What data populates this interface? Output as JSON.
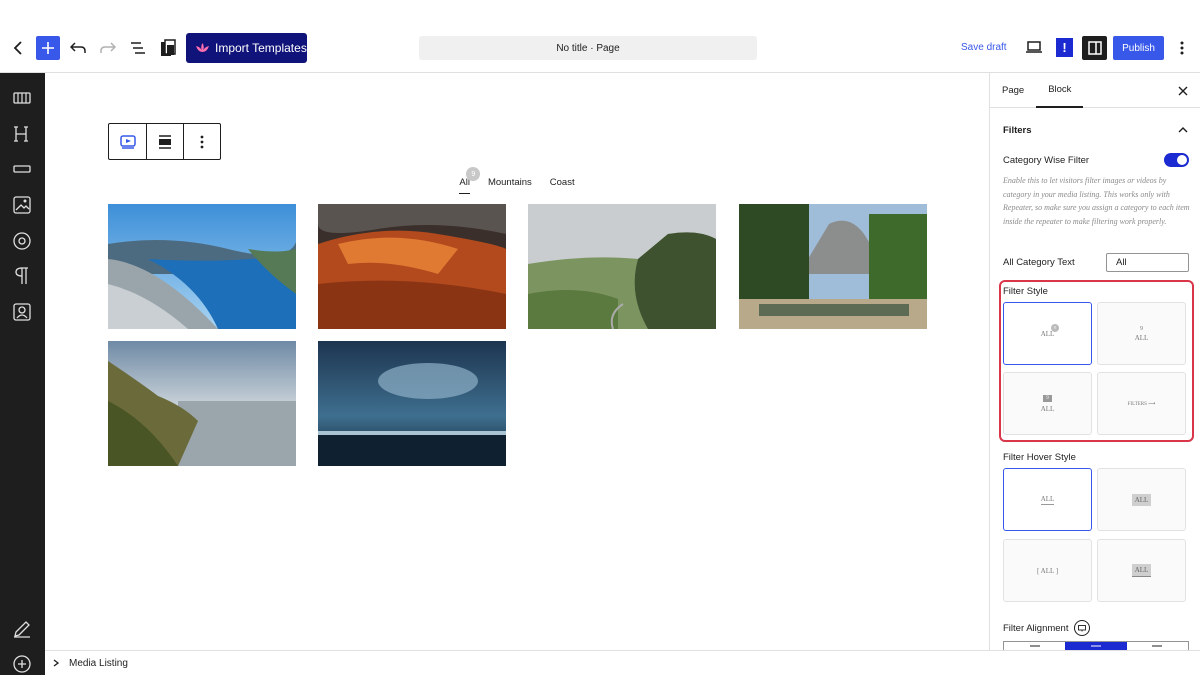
{
  "topbar": {
    "import_templates_label": "Import Templates",
    "document_title": "No title · Page",
    "save_draft_label": "Save draft",
    "alert_label": "!",
    "publish_label": "Publish",
    "colors": {
      "accent": "#3858e9",
      "import_bg": "#10147a",
      "alert_bg": "#1c2bd1"
    }
  },
  "leftbar": {
    "icons": [
      "slides-icon",
      "heading-icon",
      "divider-icon",
      "image-icon",
      "target-icon",
      "paragraph-icon",
      "contact-icon",
      "edit-icon",
      "add-circle-icon"
    ]
  },
  "canvas": {
    "filters": [
      {
        "label": "All",
        "count": "9",
        "active": true
      },
      {
        "label": "Mountains",
        "active": false
      },
      {
        "label": "Coast",
        "active": false
      }
    ],
    "images": [
      {
        "name": "fjord-cliff"
      },
      {
        "name": "red-canyon"
      },
      {
        "name": "green-valley-road"
      },
      {
        "name": "yosemite-valley"
      },
      {
        "name": "coastal-sunset"
      },
      {
        "name": "stormy-sea"
      }
    ]
  },
  "breadcrumb": {
    "label": "Media Listing"
  },
  "sidebar": {
    "tabs": [
      "Page",
      "Block"
    ],
    "active_tab": "Block",
    "panel_title": "Filters",
    "category_filter_label": "Category Wise Filter",
    "category_filter_on": true,
    "help_text": "Enable this to let visitors filter images or videos by category in your media listing. This works only with Repeater, so make sure you assign a category to each item inside the repeater to make filtering work properly.",
    "all_category_label": "All Category Text",
    "all_category_value": "All",
    "filter_style_label": "Filter Style",
    "filter_style_options": [
      {
        "text": "ALL",
        "badge": "9",
        "selected": true
      },
      {
        "text": "ALL",
        "top": "9",
        "selected": false
      },
      {
        "text": "ALL",
        "badge": "9",
        "selected": false
      },
      {
        "text": "FILTERS ⟶",
        "selected": false
      }
    ],
    "hover_style_label": "Filter Hover Style",
    "hover_style_options": [
      {
        "text": "ALL",
        "selected": true
      },
      {
        "text": "ALL",
        "selected": false
      },
      {
        "text": "[ ALL ]",
        "selected": false
      },
      {
        "text": "ALL",
        "selected": false
      }
    ],
    "alignment_label": "Filter Alignment",
    "alignment_value": "center"
  }
}
